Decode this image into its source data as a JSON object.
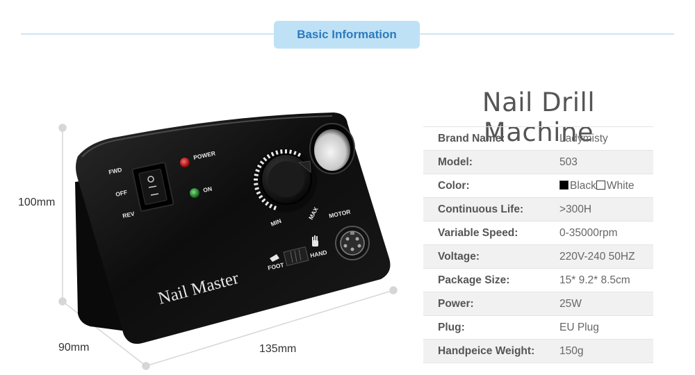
{
  "section": {
    "title": "Basic Information"
  },
  "product": {
    "title": "Nail Drill Machine"
  },
  "specs": [
    {
      "label": "Brand Name:",
      "value": "Ladymisty"
    },
    {
      "label": "Model:",
      "value": "503"
    },
    {
      "label": "Color:",
      "value": "",
      "options": [
        {
          "swatch": "#000000",
          "label": "Black"
        },
        {
          "swatch": "#ffffff",
          "label": "White"
        }
      ]
    },
    {
      "label": "Continuous Life:",
      "value": ">300H"
    },
    {
      "label": "Variable Speed:",
      "value": "0-35000rpm"
    },
    {
      "label": "Voltage:",
      "value": "220V-240 50HZ"
    },
    {
      "label": "Package Size:",
      "value": "15* 9.2* 8.5cm"
    },
    {
      "label": "Power:",
      "value": "25W"
    },
    {
      "label": "Plug:",
      "value": "EU Plug"
    },
    {
      "label": "Handpeice Weight:",
      "value": "150g"
    }
  ],
  "dimensions": {
    "height": "100mm",
    "depth": "90mm",
    "width": "135mm"
  },
  "device": {
    "brand": "Nail Master",
    "switch_labels": {
      "fwd": "FWD",
      "off": "OFF",
      "rev": "REV"
    },
    "indicators": {
      "power": "POWER",
      "on": "ON"
    },
    "dial": {
      "min": "MIN",
      "max": "MAX"
    },
    "motor": "MOTOR",
    "control": {
      "foot": "FOOT",
      "hand": "HAND"
    },
    "colors": {
      "body": "#0d0d0d",
      "power_led": "#c8141c",
      "on_led": "#1f8a2c"
    }
  }
}
